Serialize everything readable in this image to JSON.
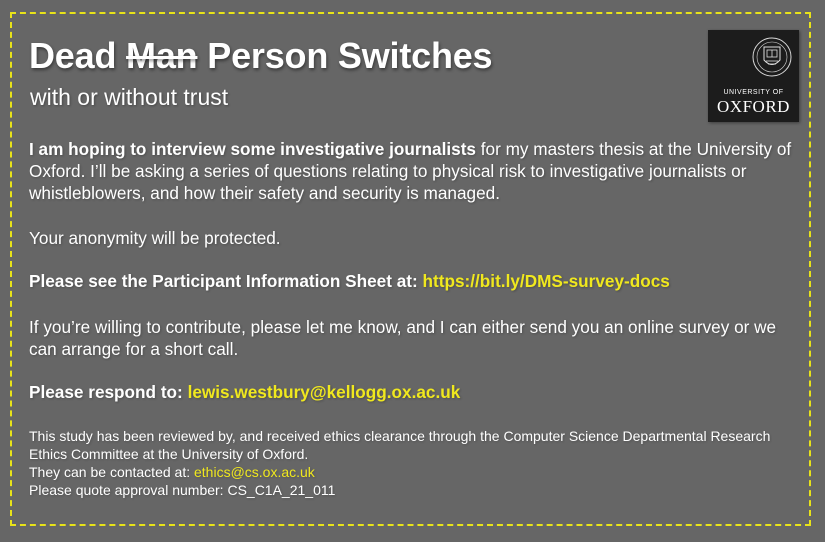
{
  "colors": {
    "background": "#666666",
    "border": "#e8e319",
    "link": "#f0e81e",
    "text": "#ffffff",
    "logo_bg": "#1c1c1c"
  },
  "header": {
    "title_word1": "Dead",
    "title_struck": "Man",
    "title_rest": "Person Switches",
    "subtitle": "with or without trust"
  },
  "logo": {
    "line1": "UNIVERSITY OF",
    "line2": "OXFORD"
  },
  "intro": {
    "bold": "I am hoping to interview some investigative journalists",
    "rest": "for my masters thesis at the University of Oxford. I’ll be asking a series of questions relating to physical risk to investigative journalists or whistleblowers, and how their safety and security is managed."
  },
  "anonymity": "Your anonymity will be protected.",
  "info_sheet": {
    "label": "Please see the Participant Information Sheet at:",
    "link": "https://bit.ly/DMS-survey-docs"
  },
  "contribute": "If you’re willing to contribute, please let me know, and I can either send you an online survey or we can arrange for a short call.",
  "respond": {
    "label": "Please respond to:",
    "email": "lewis.westbury@kellogg.ox.ac.uk"
  },
  "footer": {
    "review": "This study has been reviewed by, and received ethics clearance through the Computer Science Departmental Research Ethics Committee at the University of Oxford.",
    "contact_label": "They can be contacted at:",
    "contact_email": "ethics@cs.ox.ac.uk",
    "approval": "Please quote approval number: CS_C1A_21_011"
  }
}
